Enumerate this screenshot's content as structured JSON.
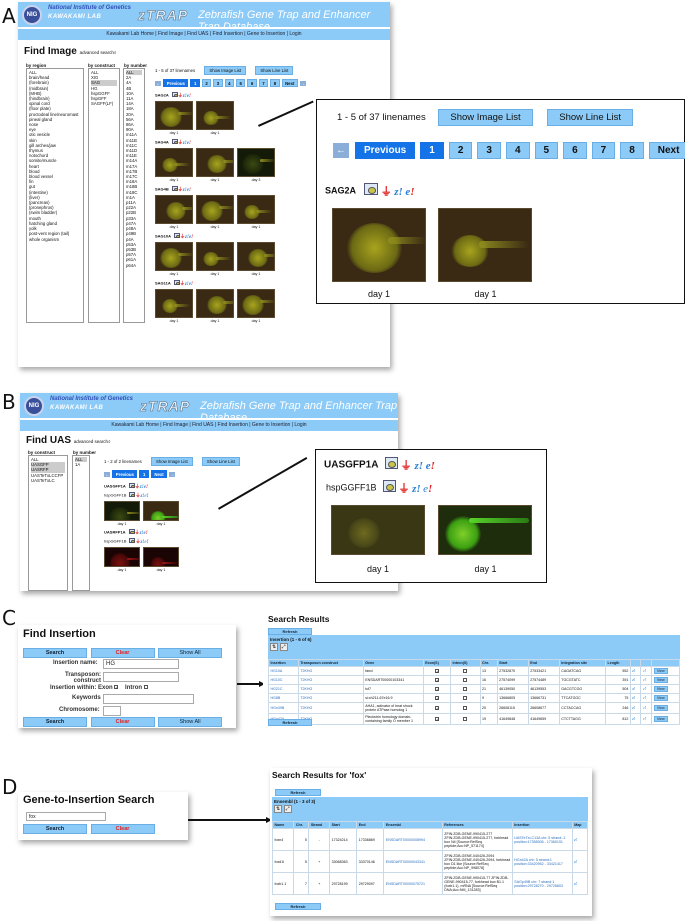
{
  "panels": {
    "A": "A",
    "B": "B",
    "C": "C",
    "D": "D"
  },
  "site": {
    "logo": "NIG",
    "institute": "National Institute of Genetics",
    "lab": "KAWAKAMI LAB",
    "brand": "zTRAP",
    "db_title": "Zebrafish Gene Trap and Enhancer Trap Database",
    "nav": "Kawakami Lab Home | Find Image | Find UAS | Find Insertion | Gene to Insertion | Login"
  },
  "find_image": {
    "title": "Find Image",
    "advanced": "advanced search",
    "by_region_label": "by region",
    "by_construct_label": "by construct",
    "by_number_label": "by number",
    "regions": [
      "ALL",
      "brain/head",
      "(forebrain)",
      "(midbrain)",
      "(MHB)",
      "(hindbrain)",
      "spinal cord",
      "(floor plate)",
      "proctodeal line/neuromast",
      "pineal gland",
      "nose",
      "eye",
      "otic vesicle",
      "skin",
      "gill arches/jaw",
      "thymus",
      "notochord",
      "somite/muscle",
      "heart",
      "blood",
      "blood vessel",
      "fin",
      "gut",
      "(intestine)",
      "(liver)",
      "(pancreas)",
      "(pronephros)",
      "(swim bladder)",
      "mouth",
      "hatching gland",
      "yolk",
      "post-vent region (tail)",
      "whole organism"
    ],
    "constructs": [
      "ALL",
      "XIG",
      "SAG",
      "HG",
      "hspGGFF",
      "hspGFF",
      "SAGFF(LF)"
    ],
    "constructs_selected": "SAG",
    "numbers": [
      "ALL",
      "2A",
      "4A",
      "4B",
      "10A",
      "11A",
      "14A",
      "18A",
      "20A",
      "56A",
      "86A",
      "90A",
      "m11A",
      "m11B",
      "m11C",
      "m11D",
      "m11E",
      "m14A",
      "m17A",
      "m17B",
      "m17C",
      "m18A",
      "m18B",
      "m18C",
      "m1A",
      "p11A",
      "p22A",
      "p22B",
      "p33A",
      "p47A",
      "p48A",
      "p49B",
      "p4A",
      "p53A",
      "p53B",
      "p57A",
      "p61A",
      "p64A"
    ],
    "range_text": "1 - 5 of 37 linenames",
    "show_image_list": "Show Image List",
    "show_line_list": "Show Line List",
    "pager": {
      "prev": "Previous",
      "next": "Next",
      "pages": [
        "1",
        "2",
        "3",
        "4",
        "5",
        "6",
        "7",
        "8"
      ],
      "current": "1"
    },
    "lines": [
      {
        "name": "SAG2A",
        "images": [
          "day 1",
          "day 1"
        ]
      },
      {
        "name": "SAG4A",
        "images": [
          "day 1",
          "day 1",
          "day 3"
        ]
      },
      {
        "name": "SAG4B",
        "images": [
          "day 1",
          "day 1",
          "day 1"
        ]
      },
      {
        "name": "SAG10A",
        "images": [
          "day 1",
          "day 1",
          "day 1"
        ]
      },
      {
        "name": "SAG11A",
        "images": [
          "day 1",
          "day 1",
          "day 1"
        ]
      }
    ]
  },
  "find_uas": {
    "title": "Find UAS",
    "advanced": "advanced search",
    "by_construct_label": "by construct",
    "by_number_label": "by number",
    "constructs": [
      "ALL",
      "UASGFP",
      "UASRFP",
      "UASTeTxLCCFP",
      "UASTeTxLC"
    ],
    "numbers": [
      "ALL",
      "1A"
    ],
    "range_text": "1 - 2 of 2 linenames",
    "show_image_list": "Show Image List",
    "show_line_list": "Show Line List",
    "pager": {
      "prev": "Previous",
      "next": "Next",
      "pages": [
        "1"
      ],
      "current": "1"
    },
    "lines": [
      {
        "name": "UASGFP1A",
        "driver": "hspGGFF1B",
        "images": [
          "day 1",
          "day 1"
        ]
      },
      {
        "name": "UASRFP1A",
        "driver": "hspGGFF1B",
        "images": [
          "day 1",
          "day 1"
        ]
      }
    ]
  },
  "find_insertion": {
    "title": "Find Insertion",
    "search": "Search",
    "clear": "Clear",
    "show_all": "Show All",
    "insertion_name_label": "Insertion name:",
    "insertion_name_value": "HG",
    "transposon_label": "Transposon: construct",
    "transposon_value": "",
    "within_label": "Insertion within:",
    "exon_label": "Exon",
    "exon_checked": true,
    "intron_label": "Intron",
    "intron_checked": false,
    "keywords_label": "Keywords",
    "keywords_value": "",
    "chromosome_label": "Chromosome:",
    "chromosome_value": ""
  },
  "insertion_results": {
    "title": "Search Results",
    "refresh": "Refresh",
    "table_title": "Insertion (1 - 6 of 6)",
    "columns": [
      "Insertion",
      "Transposon construct",
      "Gene",
      "Exon(S)",
      "Intron(S)",
      "Chr.",
      "Start",
      "End",
      "Integration site",
      "Length",
      "",
      "",
      ""
    ],
    "rows": [
      {
        "insertion": "HG10A",
        "construct": "T2KHG",
        "gene": "fancl",
        "exon": true,
        "intron": false,
        "chr": "13",
        "start": "27532870",
        "end": "27533421",
        "site": "CAGATCAG",
        "length": "552"
      },
      {
        "insertion": "HG10C",
        "construct": "T2KHG",
        "gene": "ENSDART00000103341",
        "exon": true,
        "intron": false,
        "chr": "16",
        "start": "27574099",
        "end": "27574489",
        "site": "TGCGTATC",
        "length": "391"
      },
      {
        "insertion": "HG21C",
        "construct": "T2KHG",
        "gene": "tcf7",
        "exon": true,
        "intron": false,
        "chr": "21",
        "start": "46139050",
        "end": "46139553",
        "site": "GACGTCGG",
        "length": "504"
      },
      {
        "insertion": "HG8B",
        "construct": "T2KHG",
        "gene": "si:ch211-67e16.9",
        "exon": true,
        "intron": false,
        "chr": "9",
        "start": "13666805",
        "end": "13666731",
        "site": "TTCATGGC",
        "length": "75"
      },
      {
        "insertion": "HGn39B",
        "construct": "T2KHG",
        "gene": "AHA1, activator of heat shock protein ATPase homolog 1",
        "exon": true,
        "intron": false,
        "chr": "20",
        "start": "26608115",
        "end": "26608677",
        "site": "CCTACCAG",
        "length": "246"
      },
      {
        "insertion": "HGn42A",
        "construct": "T2KHG",
        "gene": "Pleckstrin homology domain-containing family O member 1",
        "exon": true,
        "intron": false,
        "chr": "19",
        "start": "41649848",
        "end": "41649659",
        "site": "CTCTTAGG",
        "length": "812"
      }
    ],
    "view_label": "View"
  },
  "gene_to_insertion": {
    "title": "Gene-to-Insertion Search",
    "query": "fox",
    "search": "Search",
    "clear": "Clear"
  },
  "gene_results": {
    "title": "Search Results for 'fox'",
    "refresh": "Refresh",
    "table_title": "Ensembl (1 - 3 of 3)",
    "columns": [
      "Name",
      "Chr.",
      "Strand",
      "Start",
      "End",
      "Ensembl",
      "References",
      "Insertion",
      "Map"
    ],
    "rows": [
      {
        "name": "foxn4",
        "chr": "5",
        "strand": "-",
        "start": "17324214",
        "end": "17336869",
        "ensembl": "ENSDART00000008994",
        "refs": "ZFIN:ZDB-GENE-990415-277 ZFIN:ZDB-GENE-990415-277, forkhead box N4 [Source:RefSeq peptide;Acc:NP_571174]",
        "insertion": "UASTeTxLC13A chr: 5 strand:-1 position:17358306 - 17360191"
      },
      {
        "name": "foxd1l",
        "chr": "5",
        "strand": "+",
        "start": "33068363",
        "end": "33370146",
        "ensembl": "ENSDART00000043341",
        "refs": "ZFIN:ZDB-GENE-040426-2094 ZFIN:ZDB-GENE-040426-2094, forkhead box D1 like [Source:RefSeq peptide;Acc:NP_998078]",
        "insertion": "HGn42A chr: 5 strand:1 position:33420952 - 33421417"
      },
      {
        "name": "foxb1.1",
        "chr": "7",
        "strand": "+",
        "start": "29728199",
        "end": "29729097",
        "ensembl": "ENSDART00000075721",
        "refs": "ZFIN:ZDB-GENE-990415-77 ZFIN:ZDB-GENE-990415-77, forkhead box B1.1 (foxb1.1), mRNA [Source:RefSeq DNA;Acc:NM_131283]",
        "insertion": "SAGp49B chr: 7 strand:1 position:29728270 - 29728803"
      }
    ]
  },
  "colors": {
    "accent": "#8ccaf7",
    "active": "#1473e6",
    "clear": "#e02020",
    "link": "#2a6fc0"
  }
}
